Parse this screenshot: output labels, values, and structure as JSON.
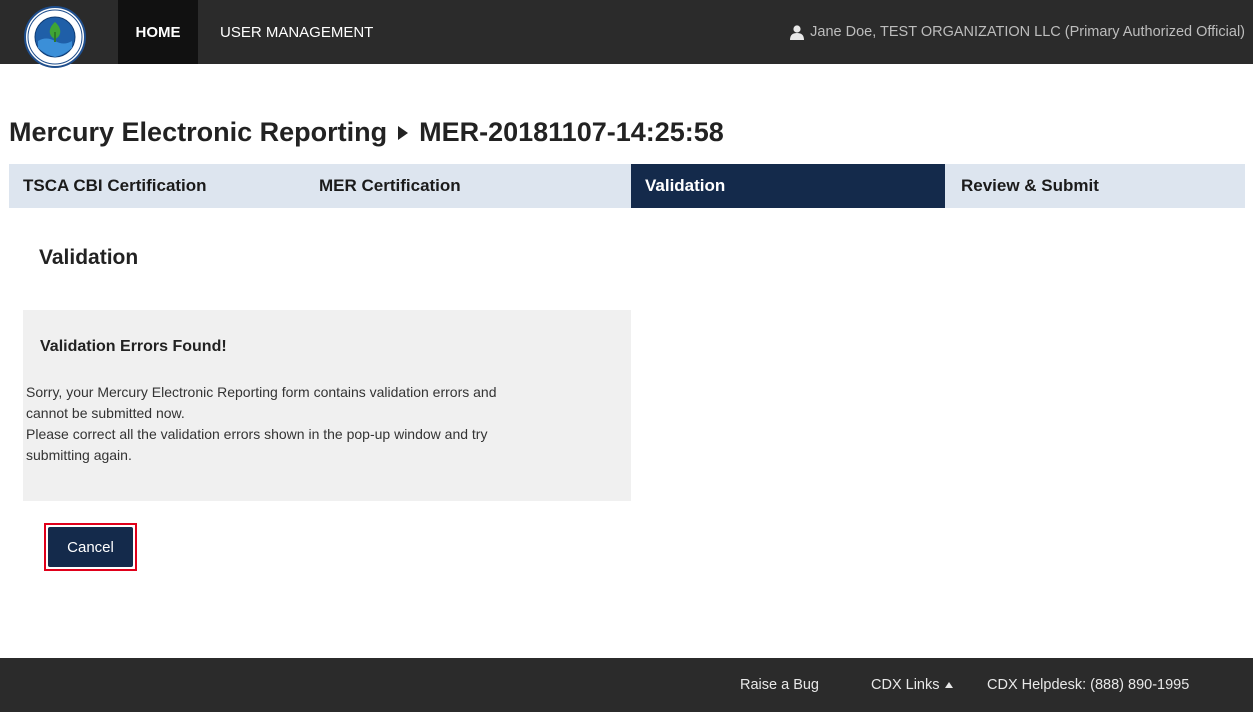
{
  "nav": {
    "home_label": "HOME",
    "user_management_label": "USER MANAGEMENT",
    "user_text": "Jane Doe, TEST ORGANIZATION LLC (Primary Authorized Official)",
    "user_icon": "user-icon",
    "logo_text": "UNITED STATES · ENVIRONMENTAL PROTECTION AGENCY"
  },
  "page": {
    "title_app": "Mercury Electronic Reporting",
    "title_record": "MER-20181107-14:25:58",
    "separator_icon": "caret-right-icon"
  },
  "steps": [
    {
      "label": "TSCA CBI Certification",
      "active": false
    },
    {
      "label": "MER Certification",
      "active": false
    },
    {
      "label": "Validation",
      "active": true
    },
    {
      "label": "Review & Submit",
      "active": false
    }
  ],
  "section": {
    "title": "Validation"
  },
  "alert": {
    "title": "Validation Errors Found!",
    "line1": "Sorry, your Mercury Electronic Reporting form contains validation errors and",
    "line2": "cannot be submitted now.",
    "line3": "Please correct all the validation errors shown in the pop-up window and try",
    "line4": "submitting again."
  },
  "actions": {
    "cancel_label": "Cancel"
  },
  "footer": {
    "raise_bug": "Raise a Bug",
    "cdx_links": "CDX Links",
    "helpdesk": "CDX Helpdesk: (888) 890-1995"
  },
  "colors": {
    "navbar_bg": "#2b2b2b",
    "active_step_bg": "#142a4b",
    "steps_bg": "#dde5ef",
    "alert_bg": "#f0f0f0",
    "highlight_border": "#e0001a"
  }
}
